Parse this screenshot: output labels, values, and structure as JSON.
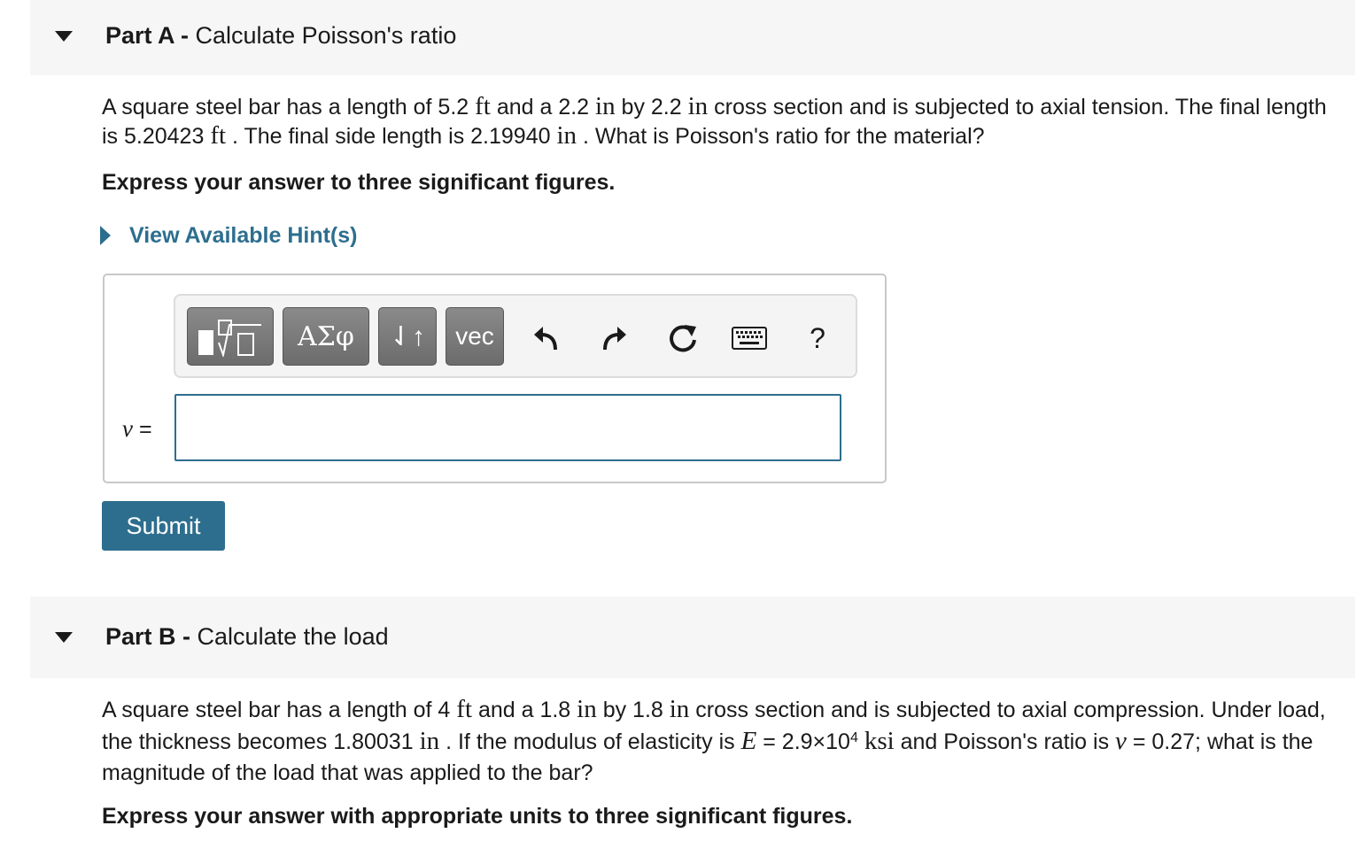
{
  "partA": {
    "label": "Part A -",
    "title": "Calculate Poisson's ratio",
    "problem": {
      "t1": "A square steel bar has a length of 5.2",
      "u1": "ft",
      "t2": "and a 2.2",
      "u2": "in",
      "t3": "by 2.2",
      "u3": "in",
      "t4": "cross section and is subjected to axial tension. The final length is 5.20423",
      "u4": "ft",
      "t5": ". The final side length is 2.19940",
      "u5": "in",
      "t6": ". What is Poisson's ratio for the material?"
    },
    "instruction": "Express your answer to three significant figures.",
    "hint_label": "View Available Hint(s)",
    "toolbar": {
      "greek_label": "ΑΣφ",
      "arrows_label": "⇃↑",
      "vec_label": "vec",
      "help_label": "?",
      "icons": [
        "templates-icon",
        "undo-icon",
        "redo-icon",
        "reset-icon",
        "keyboard-icon",
        "help-icon"
      ]
    },
    "variable": "ν",
    "equals": "=",
    "answer_value": "",
    "submit_label": "Submit"
  },
  "partB": {
    "label": "Part B -",
    "title": "Calculate the load",
    "problem": {
      "t1": "A square steel bar has a length of 4",
      "u1": "ft",
      "t2": "and a 1.8",
      "u2": "in",
      "t3": "by 1.8",
      "u3": "in",
      "t4": "cross section and is subjected to axial compression. Under load, the thickness becomes 1.80031",
      "u4": "in",
      "t5": ". If the modulus of elasticity is",
      "var_E": "E",
      "t6": "= 2.9×10",
      "exp": "4",
      "u5": "ksi",
      "t7": "and Poisson's ratio is",
      "var_nu": "ν",
      "t8": "= 0.27; what is the magnitude of the load that was applied to the bar?"
    },
    "instruction": "Express your answer with appropriate units to three significant figures."
  },
  "colors": {
    "accent": "#2d6e8e",
    "header_bg": "#f6f6f6",
    "toolbar_button": "#7a7a7a"
  }
}
